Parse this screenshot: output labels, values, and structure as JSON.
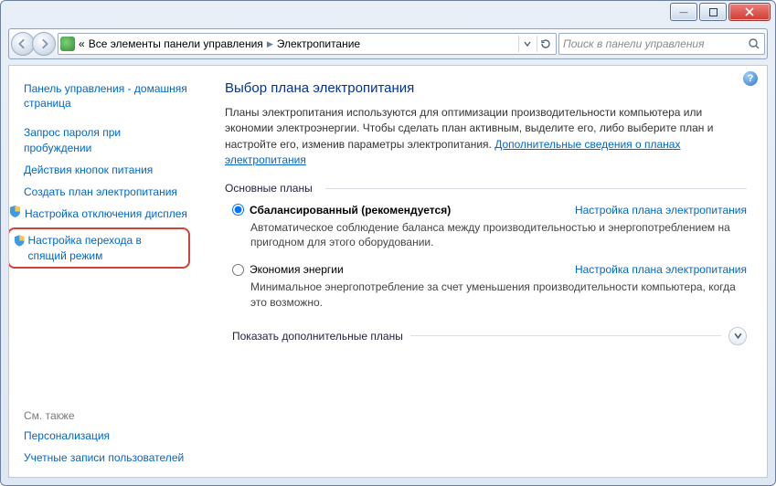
{
  "breadcrumb": {
    "prefix": "«",
    "item1": "Все элементы панели управления",
    "item2": "Электропитание"
  },
  "search": {
    "placeholder": "Поиск в панели управления"
  },
  "sidebar": {
    "home": "Панель управления - домашняя страница",
    "links": [
      "Запрос пароля при пробуждении",
      "Действия кнопок питания",
      "Создать план электропитания",
      "Настройка отключения дисплея",
      "Настройка перехода в спящий режим"
    ],
    "see_also_label": "См. также",
    "see_also": [
      "Персонализация",
      "Учетные записи пользователей"
    ]
  },
  "main": {
    "title": "Выбор плана электропитания",
    "intro_a": "Планы электропитания используются для оптимизации производительности компьютера или экономии электроэнергии. Чтобы сделать план активным, выделите его, либо выберите план и настройте его, изменив параметры электропитания. ",
    "intro_link": "Дополнительные сведения о планах электропитания",
    "group_label": "Основные планы",
    "plans": [
      {
        "name": "Сбалансированный (рекомендуется)",
        "bold": true,
        "link": "Настройка плана электропитания",
        "desc": "Автоматическое соблюдение баланса между производительностью и энергопотреблением на пригодном для этого оборудовании."
      },
      {
        "name": "Экономия энергии",
        "bold": false,
        "link": "Настройка плана электропитания",
        "desc": "Минимальное энергопотребление за счет уменьшения производительности компьютера, когда это возможно."
      }
    ],
    "show_more": "Показать дополнительные планы"
  }
}
